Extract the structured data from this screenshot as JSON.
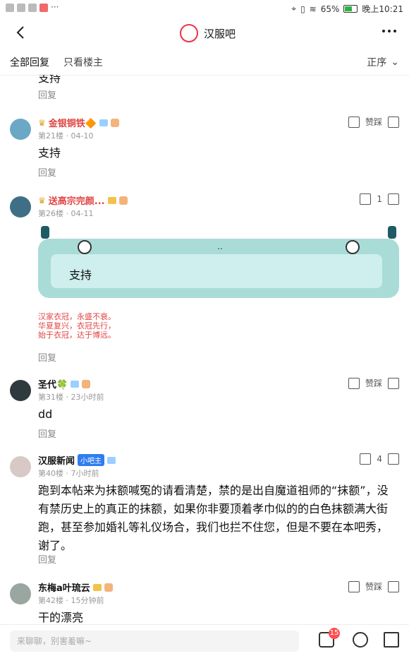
{
  "status": {
    "battery": "65%",
    "time": "晚上10:21"
  },
  "nav": {
    "title": "汉服吧"
  },
  "tabs": {
    "all": "全部回复",
    "op_only": "只看楼主",
    "sort": "正序"
  },
  "posts": [
    {
      "body": "支持",
      "reply": "回复"
    },
    {
      "name": "金银铜铁🔶",
      "meta": "第21楼 · 04-10",
      "body": "支持",
      "reply": "回复",
      "action": "赞踩"
    },
    {
      "name": "送高宗完颜...",
      "meta": "第26楼 · 04-11",
      "sticker_text": "支持",
      "sticker_dots": "..",
      "likes": "1",
      "sign_lines": [
        "汉家衣冠，永盛不衰。",
        "华夏复兴，衣冠先行，",
        "始于衣冠，达于博远。"
      ],
      "reply": "回复"
    },
    {
      "name": "圣代🍀",
      "meta": "第31楼 · 23小时前",
      "body": "dd",
      "reply": "回复",
      "action": "赞踩"
    },
    {
      "name": "汉服新闻",
      "badge": "小吧主",
      "meta": "第40楼 · 7小时前",
      "body": "跑到本帖来为抹额喊冤的请看清楚，禁的是出自魔道祖师的“抹额”，没有禁历史上的真正的抹额，如果你非要顶着孝巾似的的白色抹额满大街跑，甚至参加婚礼等礼仪场合，我们也拦不住您，但是不要在本吧秀，谢了。",
      "reply": "回复",
      "likes": "4"
    },
    {
      "name": "东梅a叶琉云",
      "meta": "第42楼 · 15分钟前",
      "body": "干的漂亮",
      "action": "赞踩"
    }
  ],
  "bottom": {
    "placeholder": "来聊聊，别害羞嘛~",
    "comment_badge": "15"
  },
  "colors": {
    "accent_red": "#e04545",
    "sticker_bg": "#a9dcd7"
  }
}
